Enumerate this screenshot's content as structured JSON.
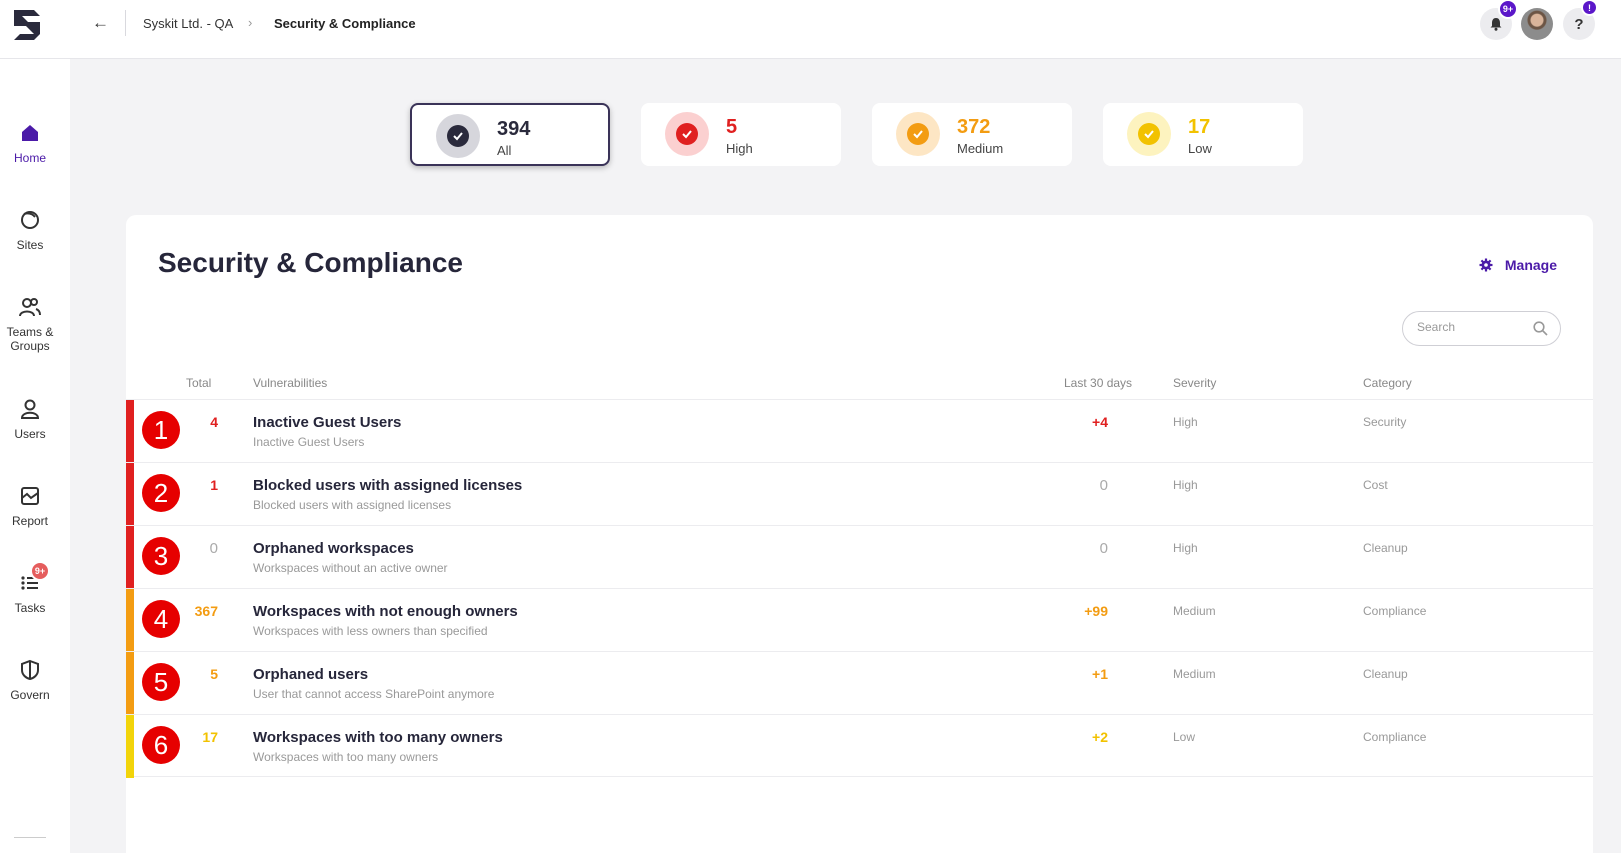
{
  "header": {
    "breadcrumb_org": "Syskit Ltd. - QA",
    "breadcrumb_sep": "›",
    "breadcrumb_current": "Security & Compliance",
    "notifications_badge": "9+",
    "help_badge": "!"
  },
  "sidebar": {
    "items": [
      {
        "label": "Home",
        "icon": "home-icon"
      },
      {
        "label": "Sites",
        "icon": "sites-icon"
      },
      {
        "label": "Teams &",
        "label2": "Groups",
        "icon": "teams-icon"
      },
      {
        "label": "Users",
        "icon": "user-icon"
      },
      {
        "label": "Report",
        "icon": "report-icon"
      },
      {
        "label": "Tasks",
        "icon": "tasks-icon",
        "badge": "9+"
      },
      {
        "label": "Govern",
        "icon": "shield-icon"
      }
    ]
  },
  "summary_cards": [
    {
      "value": "394",
      "label": "All",
      "color": "#2a2a3c"
    },
    {
      "value": "5",
      "label": "High",
      "color": "#e02020"
    },
    {
      "value": "372",
      "label": "Medium",
      "color": "#f39c12"
    },
    {
      "value": "17",
      "label": "Low",
      "color": "#f2c200"
    }
  ],
  "main": {
    "title": "Security & Compliance",
    "manage_label": "Manage",
    "search_placeholder": "Search",
    "columns": {
      "total": "Total",
      "vulnerabilities": "Vulnerabilities",
      "last30": "Last 30 days",
      "severity": "Severity",
      "category": "Category"
    },
    "rows": [
      {
        "marker": "1",
        "total": "4",
        "title": "Inactive Guest Users",
        "desc": "Inactive Guest Users",
        "last30": "+4",
        "severity": "High",
        "category": "Security"
      },
      {
        "marker": "2",
        "total": "1",
        "title": "Blocked users with assigned licenses",
        "desc": "Blocked users with assigned licenses",
        "last30": "0",
        "severity": "High",
        "category": "Cost"
      },
      {
        "marker": "3",
        "total": "0",
        "title": "Orphaned workspaces",
        "desc": "Workspaces without an active owner",
        "last30": "0",
        "severity": "High",
        "category": "Cleanup"
      },
      {
        "marker": "4",
        "total": "367",
        "title": "Workspaces with not enough owners",
        "desc": "Workspaces with less owners than specified",
        "last30": "+99",
        "severity": "Medium",
        "category": "Compliance"
      },
      {
        "marker": "5",
        "total": "5",
        "title": "Orphaned users",
        "desc": "User that cannot access SharePoint anymore",
        "last30": "+1",
        "severity": "Medium",
        "category": "Cleanup"
      },
      {
        "marker": "6",
        "total": "17",
        "title": "Workspaces with too many owners",
        "desc": "Workspaces with too many owners",
        "last30": "+2",
        "severity": "Low",
        "category": "Compliance"
      }
    ]
  },
  "colors": {
    "accent": "#4b1aa8",
    "high": "#e02020",
    "medium": "#f39c12",
    "low": "#f2c200"
  }
}
